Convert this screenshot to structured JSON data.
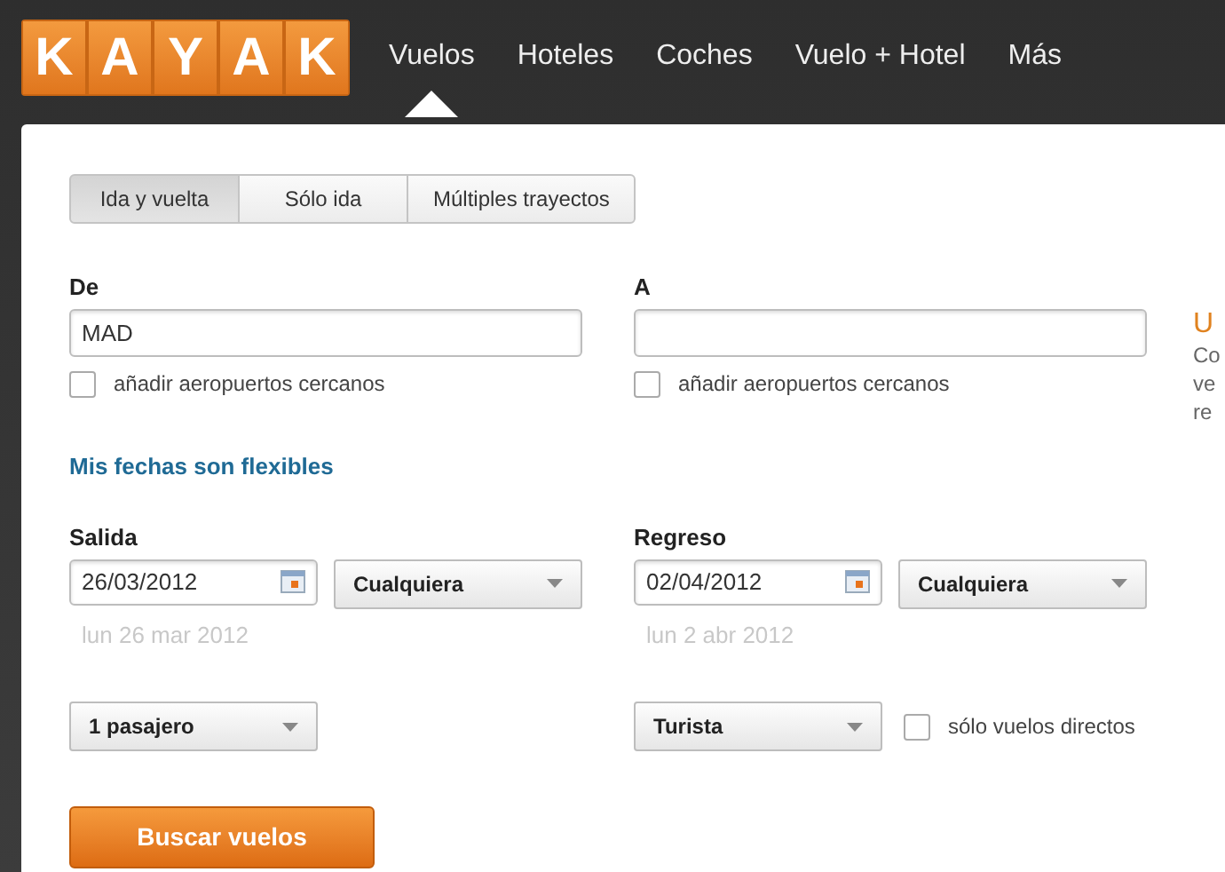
{
  "logo": {
    "letters": [
      "K",
      "A",
      "Y",
      "A",
      "K"
    ]
  },
  "nav": [
    {
      "label": "Vuelos",
      "selected": true
    },
    {
      "label": "Hoteles",
      "selected": false
    },
    {
      "label": "Coches",
      "selected": false
    },
    {
      "label": "Vuelo + Hotel",
      "selected": false
    },
    {
      "label": "Más",
      "selected": false
    }
  ],
  "trip_tabs": [
    {
      "label": "Ida y vuelta",
      "selected": true
    },
    {
      "label": "Sólo ida",
      "selected": false
    },
    {
      "label": "Múltiples trayectos",
      "selected": false
    }
  ],
  "origin": {
    "label": "De",
    "value": "MAD",
    "nearby": {
      "label": "añadir aeropuertos cercanos",
      "checked": false
    }
  },
  "destination": {
    "label": "A",
    "nearby": {
      "label": "añadir aeropuertos cercanos",
      "checked": false
    }
  },
  "flexible_link": "Mis fechas son flexibles",
  "departure": {
    "label": "Salida",
    "date": "26/03/2012",
    "time": "Cualquiera",
    "hint": "lun 26 mar 2012"
  },
  "return": {
    "label": "Regreso",
    "date": "02/04/2012",
    "time": "Cualquiera",
    "hint": "lun 2 abr 2012"
  },
  "passengers": "1 pasajero",
  "cabin": "Turista",
  "direct_only": {
    "label": "sólo vuelos directos",
    "checked": false
  },
  "search_button": "Buscar vuelos",
  "side_note": {
    "title": "U",
    "lines": [
      "Co",
      "ve",
      "re"
    ]
  }
}
